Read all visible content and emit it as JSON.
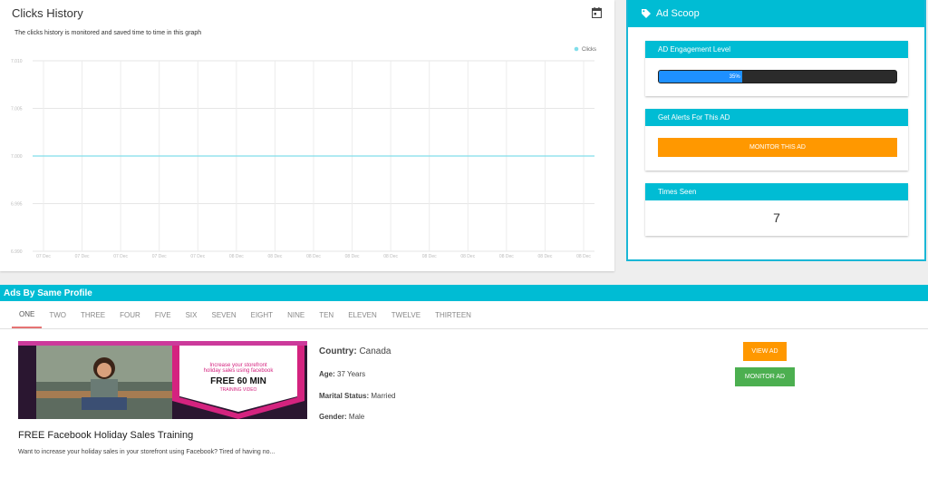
{
  "clicks": {
    "title": "Clicks History",
    "subtitle": "The clicks history is monitored and saved time to time in this graph",
    "calendar_icon": "calendar-icon"
  },
  "chart_data": {
    "type": "line",
    "x": [
      "07 Dec",
      "07 Dec",
      "07 Dec",
      "07 Dec",
      "07 Dec",
      "08 Dec",
      "08 Dec",
      "08 Dec",
      "08 Dec",
      "08 Dec",
      "08 Dec",
      "08 Dec",
      "08 Dec",
      "08 Dec",
      "08 Dec"
    ],
    "series": [
      {
        "name": "Clicks",
        "values": [
          7,
          7,
          7,
          7,
          7,
          7,
          7,
          7,
          7,
          7,
          7,
          7,
          7,
          7,
          7
        ],
        "color": "#80deea"
      }
    ],
    "yticks": [
      "7.010",
      "7.005",
      "7.000",
      "6.995",
      "6.990"
    ],
    "ylim": [
      6.99,
      7.01
    ],
    "grid": true,
    "legend": "top-right"
  },
  "scoop": {
    "title": "Ad Scoop",
    "icon": "tag-icon",
    "engagement": {
      "label": "AD Engagement Level",
      "value": 35,
      "text": "35%"
    },
    "alerts": {
      "label": "Get Alerts For This AD",
      "button": "MONITOR THIS AD"
    },
    "times_seen": {
      "label": "Times Seen",
      "value": "7"
    }
  },
  "ads": {
    "heading": "Ads By Same Profile",
    "tabs": [
      "ONE",
      "TWO",
      "THREE",
      "FOUR",
      "FIVE",
      "SIX",
      "SEVEN",
      "EIGHT",
      "NINE",
      "TEN",
      "ELEVEN",
      "TWELVE",
      "THIRTEEN"
    ],
    "active_tab": "ONE",
    "item": {
      "thumb_line1": "Increase your storefront",
      "thumb_line2": "holiday sales using facebook",
      "thumb_big": "FREE 60 MIN",
      "thumb_small": "TRAINING VIDEO",
      "title": "FREE Facebook Holiday Sales Training",
      "desc": "Want to increase your holiday sales in your storefront using Facebook? Tired of having no...",
      "country_label": "Country:",
      "country": "Canada",
      "age_label": "Age:",
      "age": "37 Years",
      "marital_label": "Marital Status:",
      "marital": "Married",
      "gender_label": "Gender:",
      "gender": "Male",
      "view_button": "VIEW AD",
      "monitor_button": "MONITOR AD"
    }
  },
  "colors": {
    "accent": "#00bcd4",
    "orange": "#ff9800",
    "green": "#4caf50",
    "progress": "#1e90ff"
  }
}
